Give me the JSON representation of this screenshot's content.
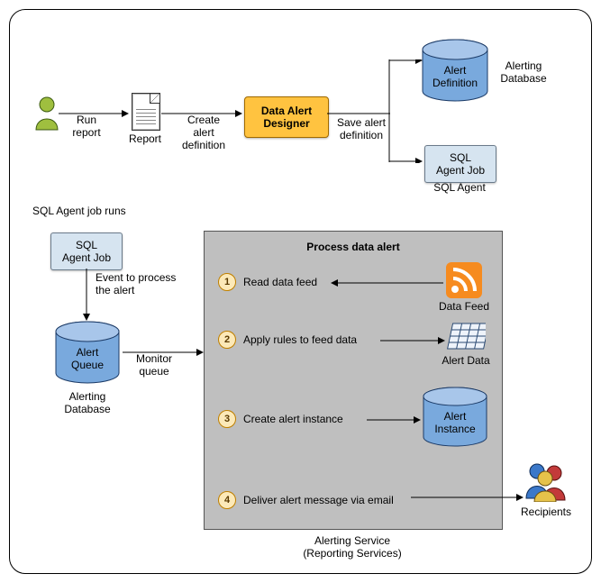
{
  "top": {
    "run_report": "Run\nreport",
    "report": "Report",
    "create_def": "Create\nalert\ndefinition",
    "designer": "Data Alert\nDesigner",
    "save_def": "Save alert\ndefinition",
    "alert_definition": "Alert\nDefinition",
    "alerting_db": "Alerting\nDatabase",
    "sql_agent_job": "SQL\nAgent Job",
    "sql_agent": "SQL Agent"
  },
  "mid": {
    "job_runs": "SQL Agent job runs",
    "sql_agent_job": "SQL\nAgent Job",
    "event_text": "Event to process\nthe alert",
    "alert_queue": "Alert\nQueue",
    "alerting_db": "Alerting\nDatabase",
    "monitor_queue": "Monitor\nqueue"
  },
  "svc": {
    "title": "Process data alert",
    "s1": "1",
    "s1_label": "Read data feed",
    "s2": "2",
    "s2_label": "Apply rules to feed data",
    "s3": "3",
    "s3_label": "Create alert instance",
    "s4": "4",
    "s4_label": "Deliver alert message via email",
    "data_feed": "Data Feed",
    "alert_data": "Alert Data",
    "alert_instance": "Alert\nInstance",
    "caption": "Alerting Service\n(Reporting Services)"
  },
  "recipients": "Recipients"
}
